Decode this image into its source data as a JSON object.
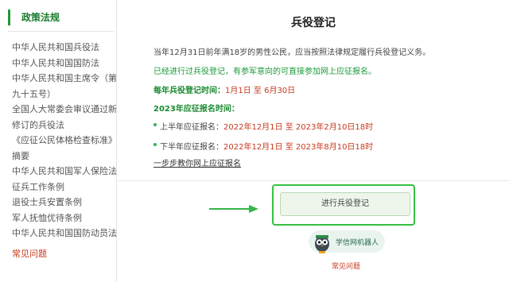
{
  "sidebar": {
    "heading": "政策法规",
    "items": [
      "中华人民共和国兵役法",
      "中华人民共和国国防法",
      "中华人民共和国主席令（第",
      "九十五号）",
      "全国人大常委会审议通过新",
      "修订的兵役法",
      "《应征公民体格检查标准》",
      "摘要",
      "中华人民共和国军人保险法",
      "征兵工作条例",
      "退役士兵安置条例",
      "军人抚恤优待条例",
      "中华人民共和国国防动员法"
    ],
    "faq": "常见问题"
  },
  "main": {
    "title": "兵役登记",
    "intro": "当年12月31日前年满18岁的男性公民，应当按照法律规定履行兵役登记义务。",
    "note": "已经进行过兵役登记，有参军意向的可直接参加网上应征报名。",
    "reg_time_label": "每年兵役登记时间：",
    "reg_time_value": "1月1日 至 6月30日",
    "apply_heading": "2023年应征报名时间：",
    "h1_label": "上半年应征报名：",
    "h1_value": "2022年12月1日 至 2023年2月10日18时",
    "h2_label": "下半年应征报名：",
    "h2_value": "2022年12月1日 至 2023年8月10日18时",
    "guide_link": "一步步教你网上应征报名",
    "register_button": "进行兵役登记",
    "robot_label": "学信网机器人",
    "faq": "常见问题"
  },
  "colors": {
    "accent_green": "#1a9a3a",
    "highlight_green": "#35c043",
    "date_red": "#c8381e"
  }
}
